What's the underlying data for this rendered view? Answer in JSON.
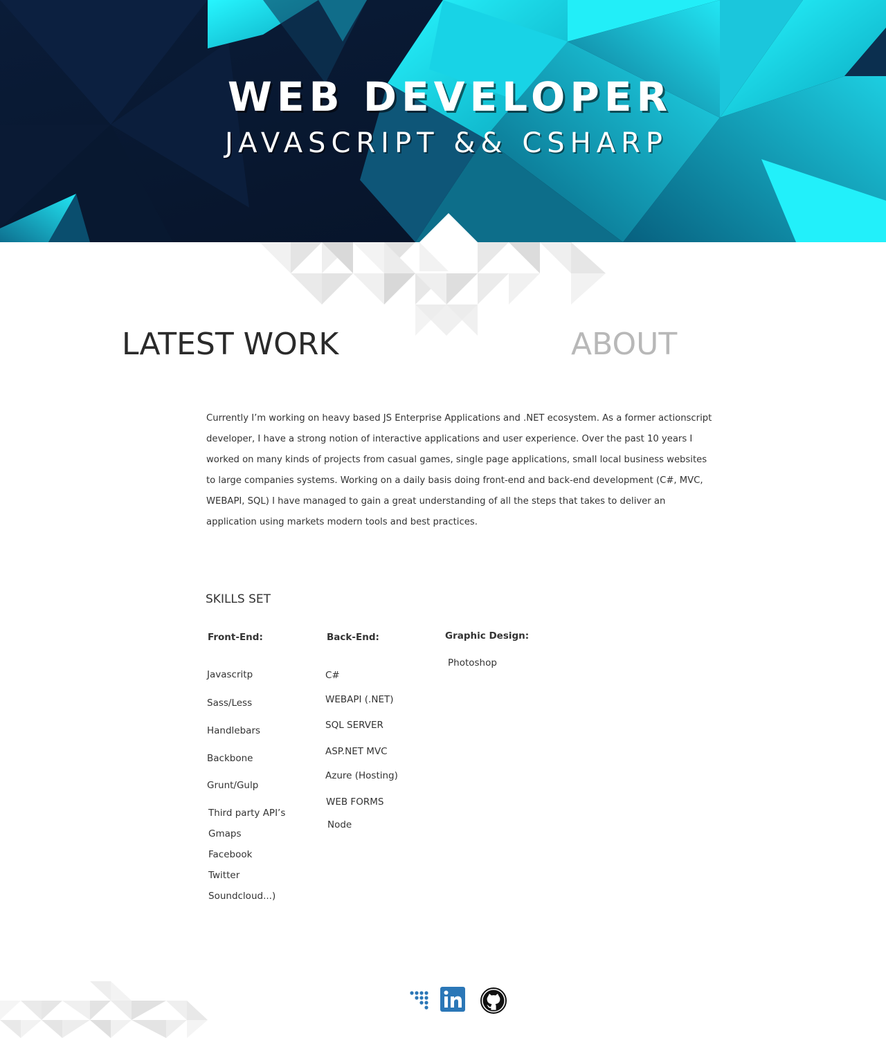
{
  "hero": {
    "title": "WEB DEVELOPER",
    "subtitle": "JAVASCRIPT && CSHARP"
  },
  "nav": {
    "latest_work": "LATEST WORK",
    "about": "ABOUT"
  },
  "about": {
    "text": "Currently I’m working on heavy based JS Enterprise Applications and .NET ecosystem. As a former actionscript developer, I have a strong notion of interactive applications and user experience. Over the past 10 years I worked on many kinds of projects from casual games, single page applications, small local business websites to large companies systems. Working on a daily basis doing front-end  and back-end development (C#, MVC, WEBAPI, SQL) I have managed to gain a great  understanding of all the steps that takes to deliver an application using markets modern tools and best practices."
  },
  "skills": {
    "title": "SKILLS SET",
    "frontend": {
      "heading": "Front-End:",
      "items": [
        "Javascritp",
        "Sass/Less",
        "Handlebars",
        "Backbone",
        "Grunt/Gulp",
        "Third party API’s",
        "Gmaps",
        "Facebook",
        "Twitter",
        "Soundcloud...)"
      ]
    },
    "backend": {
      "heading": "Back-End:",
      "items": [
        "C#",
        "WEBAPI (.NET)",
        "SQL SERVER",
        "ASP.NET MVC",
        "Azure (Hosting)",
        "WEB FORMS",
        "Node"
      ]
    },
    "design": {
      "heading": "Graphic Design:",
      "items": [
        "Photoshop"
      ]
    }
  },
  "social": {
    "icons": [
      "dots-logo-icon",
      "linkedin-icon",
      "github-icon"
    ],
    "linkedin_label": "in"
  },
  "colors": {
    "hero_dark": "#07172f",
    "hero_cyan": "#1ee8f5",
    "linkedin_blue": "#2b77b7",
    "about_gray": "#b8b8b8"
  }
}
